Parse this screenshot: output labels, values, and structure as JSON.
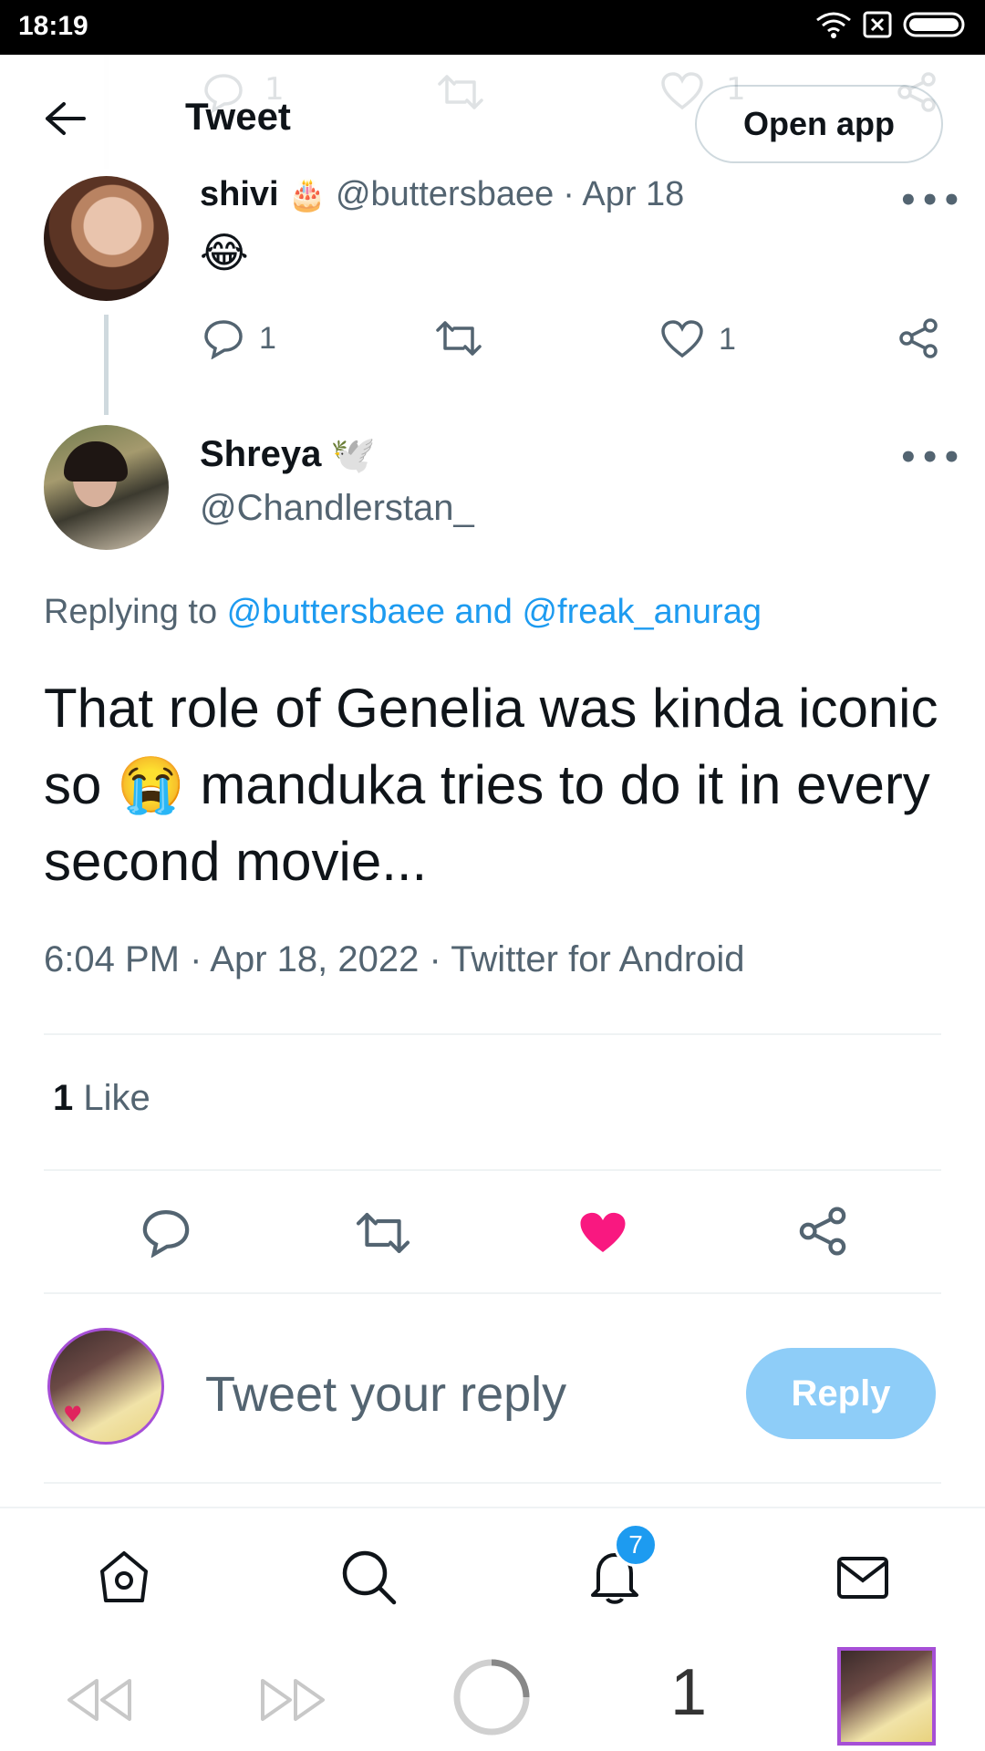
{
  "status_bar": {
    "time": "18:19"
  },
  "header": {
    "title": "Tweet",
    "open_app": "Open app"
  },
  "previous_tweet": {
    "name": "shivi",
    "name_emoji": "🎂",
    "handle": "@buttersbaee",
    "date": "· Apr 18",
    "text": "😂",
    "reply_count": "1",
    "like_count": "1",
    "ghost_reply_count": "1",
    "ghost_like_count": "1"
  },
  "main_tweet": {
    "name": "Shreya",
    "name_emoji": "🕊️",
    "handle": "@Chandlerstan_",
    "replying_prefix": "Replying to ",
    "replying_users": "@buttersbaee and @freak_anurag",
    "text": "That role of Genelia was kinda iconic so 😭 manduka tries to do it in every second movie...",
    "timestamp": "6:04 PM · Apr 18, 2022 · Twitter for Android",
    "like_count": "1",
    "like_label": " Like"
  },
  "reply_composer": {
    "placeholder": "Tweet your reply",
    "button": "Reply"
  },
  "bottom_nav": {
    "notification_badge": "7"
  },
  "browser": {
    "tab_count": "1"
  },
  "colors": {
    "accent": "#1d9bf0",
    "like": "#f91880",
    "reply_button": "#8ecdf8"
  }
}
